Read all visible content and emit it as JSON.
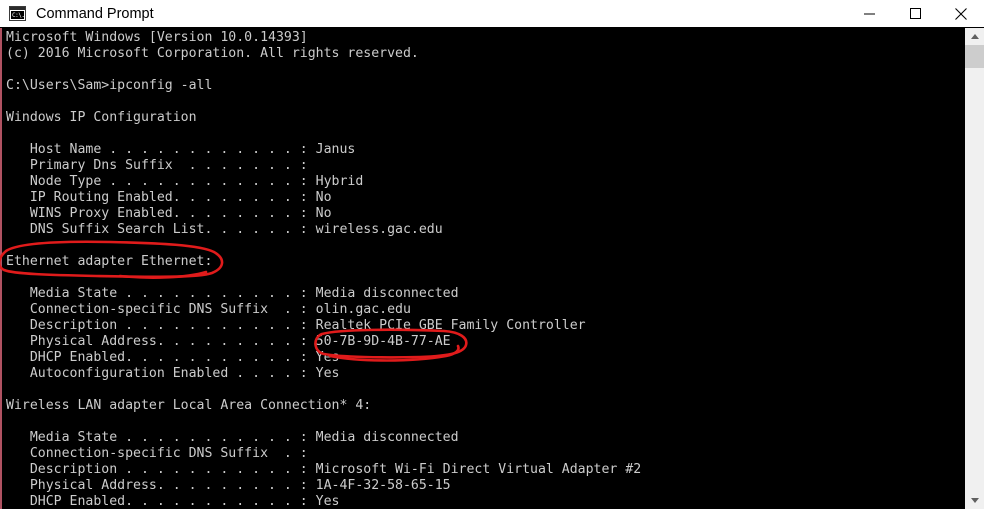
{
  "window": {
    "title": "Command Prompt",
    "icon": "command-prompt-icon",
    "icon_glyph": "C:\\.",
    "controls": {
      "minimize": "Minimize",
      "maximize": "Maximize",
      "close": "Close"
    }
  },
  "scrollbar": {
    "up_label": "Scroll up",
    "down_label": "Scroll down",
    "thumb_label": "Scroll thumb"
  },
  "terminal": {
    "background_color": "#000000",
    "text_color": "#cccccc",
    "content": "Microsoft Windows [Version 10.0.14393]\n(c) 2016 Microsoft Corporation. All rights reserved.\n\nC:\\Users\\Sam>ipconfig -all\n\nWindows IP Configuration\n\n   Host Name . . . . . . . . . . . . : Janus\n   Primary Dns Suffix  . . . . . . . :\n   Node Type . . . . . . . . . . . . : Hybrid\n   IP Routing Enabled. . . . . . . . : No\n   WINS Proxy Enabled. . . . . . . . : No\n   DNS Suffix Search List. . . . . . : wireless.gac.edu\n\nEthernet adapter Ethernet:\n\n   Media State . . . . . . . . . . . : Media disconnected\n   Connection-specific DNS Suffix  . : olin.gac.edu\n   Description . . . . . . . . . . . : Realtek PCIe GBE Family Controller\n   Physical Address. . . . . . . . . : 50-7B-9D-4B-77-AE\n   DHCP Enabled. . . . . . . . . . . : Yes\n   Autoconfiguration Enabled . . . . : Yes\n\nWireless LAN adapter Local Area Connection* 4:\n\n   Media State . . . . . . . . . . . : Media disconnected\n   Connection-specific DNS Suffix  . :\n   Description . . . . . . . . . . . : Microsoft Wi-Fi Direct Virtual Adapter #2\n   Physical Address. . . . . . . . . : 1A-4F-32-58-65-15\n   DHCP Enabled. . . . . . . . . . . : Yes",
    "command_line": {
      "prompt": "C:\\Users\\Sam>",
      "command": "ipconfig -all"
    },
    "sections": [
      {
        "heading": "Windows IP Configuration",
        "fields": [
          {
            "label": "Host Name",
            "value": "Janus"
          },
          {
            "label": "Primary Dns Suffix",
            "value": ""
          },
          {
            "label": "Node Type",
            "value": "Hybrid"
          },
          {
            "label": "IP Routing Enabled",
            "value": "No"
          },
          {
            "label": "WINS Proxy Enabled",
            "value": "No"
          },
          {
            "label": "DNS Suffix Search List",
            "value": "wireless.gac.edu"
          }
        ]
      },
      {
        "heading": "Ethernet adapter Ethernet:",
        "fields": [
          {
            "label": "Media State",
            "value": "Media disconnected"
          },
          {
            "label": "Connection-specific DNS Suffix",
            "value": "olin.gac.edu"
          },
          {
            "label": "Description",
            "value": "Realtek PCIe GBE Family Controller"
          },
          {
            "label": "Physical Address",
            "value": "50-7B-9D-4B-77-AE"
          },
          {
            "label": "DHCP Enabled",
            "value": "Yes"
          },
          {
            "label": "Autoconfiguration Enabled",
            "value": "Yes"
          }
        ]
      },
      {
        "heading": "Wireless LAN adapter Local Area Connection* 4:",
        "fields": [
          {
            "label": "Media State",
            "value": "Media disconnected"
          },
          {
            "label": "Connection-specific DNS Suffix",
            "value": ""
          },
          {
            "label": "Description",
            "value": "Microsoft Wi-Fi Direct Virtual Adapter #2"
          },
          {
            "label": "Physical Address",
            "value": "1A-4F-32-58-65-15"
          },
          {
            "label": "DHCP Enabled",
            "value": "Yes"
          }
        ]
      }
    ]
  },
  "annotations": {
    "color": "#e01b1b",
    "items": [
      {
        "name": "ethernet-adapter-heading-circle",
        "target": "Ethernet adapter Ethernet:"
      },
      {
        "name": "physical-address-circle",
        "target": "50-7B-9D-4B-77-AE"
      }
    ]
  }
}
